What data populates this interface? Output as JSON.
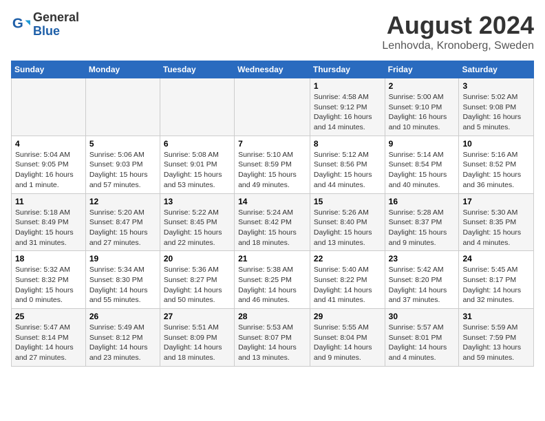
{
  "header": {
    "logo_general": "General",
    "logo_blue": "Blue",
    "title": "August 2024",
    "subtitle": "Lenhovda, Kronoberg, Sweden"
  },
  "weekdays": [
    "Sunday",
    "Monday",
    "Tuesday",
    "Wednesday",
    "Thursday",
    "Friday",
    "Saturday"
  ],
  "weeks": [
    [
      {
        "day": "",
        "info": ""
      },
      {
        "day": "",
        "info": ""
      },
      {
        "day": "",
        "info": ""
      },
      {
        "day": "",
        "info": ""
      },
      {
        "day": "1",
        "info": "Sunrise: 4:58 AM\nSunset: 9:12 PM\nDaylight: 16 hours\nand 14 minutes."
      },
      {
        "day": "2",
        "info": "Sunrise: 5:00 AM\nSunset: 9:10 PM\nDaylight: 16 hours\nand 10 minutes."
      },
      {
        "day": "3",
        "info": "Sunrise: 5:02 AM\nSunset: 9:08 PM\nDaylight: 16 hours\nand 5 minutes."
      }
    ],
    [
      {
        "day": "4",
        "info": "Sunrise: 5:04 AM\nSunset: 9:05 PM\nDaylight: 16 hours\nand 1 minute."
      },
      {
        "day": "5",
        "info": "Sunrise: 5:06 AM\nSunset: 9:03 PM\nDaylight: 15 hours\nand 57 minutes."
      },
      {
        "day": "6",
        "info": "Sunrise: 5:08 AM\nSunset: 9:01 PM\nDaylight: 15 hours\nand 53 minutes."
      },
      {
        "day": "7",
        "info": "Sunrise: 5:10 AM\nSunset: 8:59 PM\nDaylight: 15 hours\nand 49 minutes."
      },
      {
        "day": "8",
        "info": "Sunrise: 5:12 AM\nSunset: 8:56 PM\nDaylight: 15 hours\nand 44 minutes."
      },
      {
        "day": "9",
        "info": "Sunrise: 5:14 AM\nSunset: 8:54 PM\nDaylight: 15 hours\nand 40 minutes."
      },
      {
        "day": "10",
        "info": "Sunrise: 5:16 AM\nSunset: 8:52 PM\nDaylight: 15 hours\nand 36 minutes."
      }
    ],
    [
      {
        "day": "11",
        "info": "Sunrise: 5:18 AM\nSunset: 8:49 PM\nDaylight: 15 hours\nand 31 minutes."
      },
      {
        "day": "12",
        "info": "Sunrise: 5:20 AM\nSunset: 8:47 PM\nDaylight: 15 hours\nand 27 minutes."
      },
      {
        "day": "13",
        "info": "Sunrise: 5:22 AM\nSunset: 8:45 PM\nDaylight: 15 hours\nand 22 minutes."
      },
      {
        "day": "14",
        "info": "Sunrise: 5:24 AM\nSunset: 8:42 PM\nDaylight: 15 hours\nand 18 minutes."
      },
      {
        "day": "15",
        "info": "Sunrise: 5:26 AM\nSunset: 8:40 PM\nDaylight: 15 hours\nand 13 minutes."
      },
      {
        "day": "16",
        "info": "Sunrise: 5:28 AM\nSunset: 8:37 PM\nDaylight: 15 hours\nand 9 minutes."
      },
      {
        "day": "17",
        "info": "Sunrise: 5:30 AM\nSunset: 8:35 PM\nDaylight: 15 hours\nand 4 minutes."
      }
    ],
    [
      {
        "day": "18",
        "info": "Sunrise: 5:32 AM\nSunset: 8:32 PM\nDaylight: 15 hours\nand 0 minutes."
      },
      {
        "day": "19",
        "info": "Sunrise: 5:34 AM\nSunset: 8:30 PM\nDaylight: 14 hours\nand 55 minutes."
      },
      {
        "day": "20",
        "info": "Sunrise: 5:36 AM\nSunset: 8:27 PM\nDaylight: 14 hours\nand 50 minutes."
      },
      {
        "day": "21",
        "info": "Sunrise: 5:38 AM\nSunset: 8:25 PM\nDaylight: 14 hours\nand 46 minutes."
      },
      {
        "day": "22",
        "info": "Sunrise: 5:40 AM\nSunset: 8:22 PM\nDaylight: 14 hours\nand 41 minutes."
      },
      {
        "day": "23",
        "info": "Sunrise: 5:42 AM\nSunset: 8:20 PM\nDaylight: 14 hours\nand 37 minutes."
      },
      {
        "day": "24",
        "info": "Sunrise: 5:45 AM\nSunset: 8:17 PM\nDaylight: 14 hours\nand 32 minutes."
      }
    ],
    [
      {
        "day": "25",
        "info": "Sunrise: 5:47 AM\nSunset: 8:14 PM\nDaylight: 14 hours\nand 27 minutes."
      },
      {
        "day": "26",
        "info": "Sunrise: 5:49 AM\nSunset: 8:12 PM\nDaylight: 14 hours\nand 23 minutes."
      },
      {
        "day": "27",
        "info": "Sunrise: 5:51 AM\nSunset: 8:09 PM\nDaylight: 14 hours\nand 18 minutes."
      },
      {
        "day": "28",
        "info": "Sunrise: 5:53 AM\nSunset: 8:07 PM\nDaylight: 14 hours\nand 13 minutes."
      },
      {
        "day": "29",
        "info": "Sunrise: 5:55 AM\nSunset: 8:04 PM\nDaylight: 14 hours\nand 9 minutes."
      },
      {
        "day": "30",
        "info": "Sunrise: 5:57 AM\nSunset: 8:01 PM\nDaylight: 14 hours\nand 4 minutes."
      },
      {
        "day": "31",
        "info": "Sunrise: 5:59 AM\nSunset: 7:59 PM\nDaylight: 13 hours\nand 59 minutes."
      }
    ]
  ]
}
